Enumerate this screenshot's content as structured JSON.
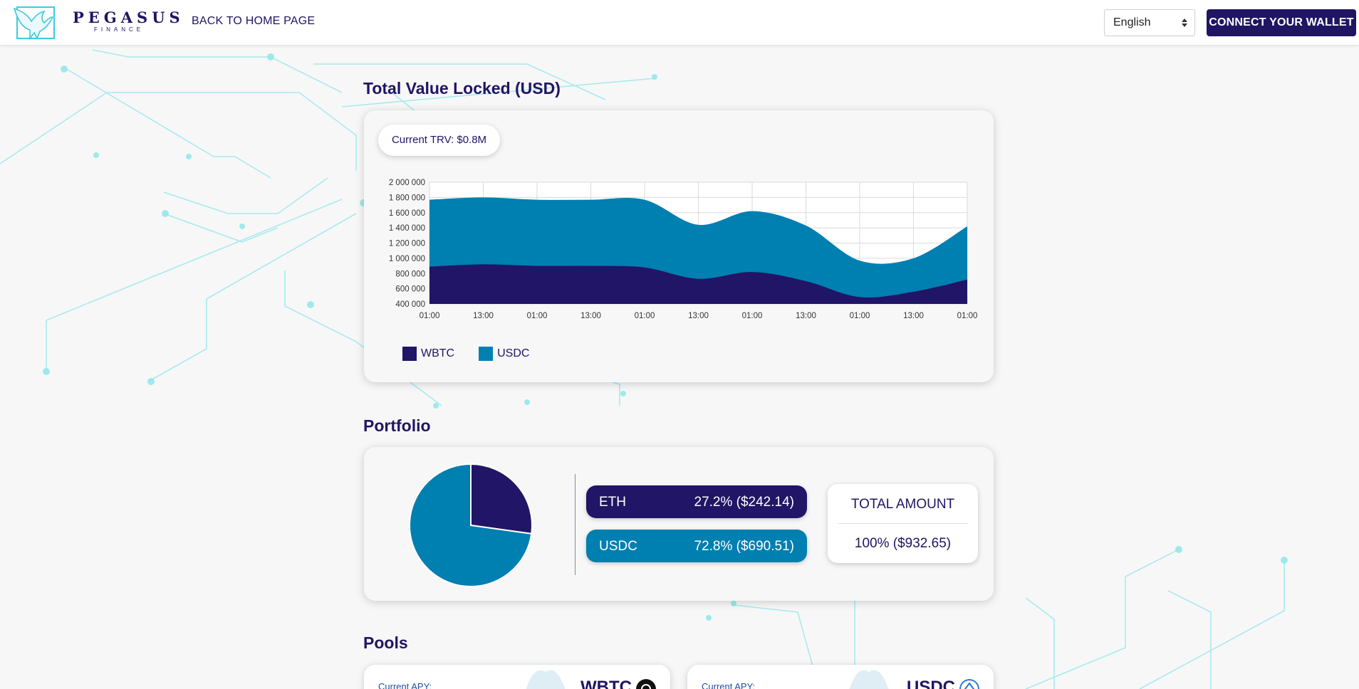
{
  "header": {
    "brand_name": "PEGASUS",
    "brand_sub": "FINANCE",
    "back_link": "BACK TO HOME PAGE",
    "language": "English",
    "wallet_button": "CONNECT YOUR WALLET"
  },
  "tvl": {
    "title": "Total Value Locked (USD)",
    "current_trv": "Current TRV: $0.8M",
    "legend": [
      {
        "label": "WBTC",
        "color": "#201566"
      },
      {
        "label": "USDC",
        "color": "#007fb1"
      }
    ]
  },
  "chart_data": {
    "type": "area",
    "stacked": true,
    "x": [
      "01:00",
      "13:00",
      "01:00",
      "13:00",
      "01:00",
      "13:00",
      "01:00",
      "13:00",
      "01:00",
      "13:00",
      "01:00"
    ],
    "ylim": [
      400000,
      2000000
    ],
    "yticks": [
      "2 000 000",
      "1 800 000",
      "1 600 000",
      "1 400 000",
      "1 200 000",
      "1 000 000",
      "800 000",
      "600 000",
      "400 000"
    ],
    "grid": true,
    "legend_position": "bottom-left",
    "series": [
      {
        "name": "WBTC",
        "color": "#201566",
        "values": [
          890000,
          920000,
          900000,
          900000,
          880000,
          730000,
          820000,
          700000,
          490000,
          560000,
          720000
        ]
      },
      {
        "name": "USDC",
        "color": "#007fb1",
        "values": [
          880000,
          880000,
          870000,
          870000,
          890000,
          710000,
          800000,
          730000,
          480000,
          440000,
          700000
        ]
      }
    ]
  },
  "portfolio": {
    "title": "Portfolio",
    "pie": [
      {
        "label": "ETH",
        "percent": 27.2,
        "color": "#201566"
      },
      {
        "label": "USDC",
        "percent": 72.8,
        "color": "#007fb1"
      }
    ],
    "assets": [
      {
        "name": "ETH",
        "value": "27.2% ($242.14)",
        "color": "#201566"
      },
      {
        "name": "USDC",
        "value": "72.8% ($690.51)",
        "color": "#007fb1"
      }
    ],
    "total_label": "TOTAL AMOUNT",
    "total_value": "100% ($932.65)"
  },
  "pools": {
    "title": "Pools",
    "items": [
      {
        "apy_label": "Current APY:",
        "coin": "WBTC"
      },
      {
        "apy_label": "Current APY:",
        "coin": "USDC"
      }
    ]
  }
}
